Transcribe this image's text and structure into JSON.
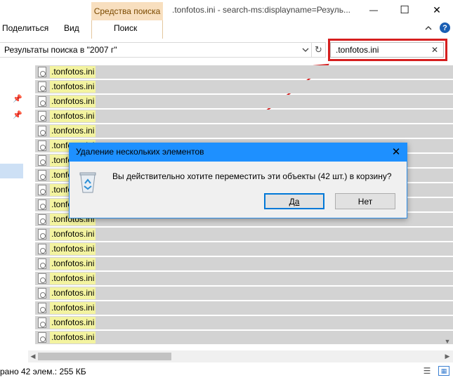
{
  "window": {
    "title": ".tonfotos.ini - search-ms:displayname=Резуль...",
    "minimize_symbol": "—",
    "maximize_symbol": "☐",
    "close_symbol": "✕"
  },
  "ribbon": {
    "contextual_header": "Средства поиска",
    "tabs": [
      {
        "label": "Поделиться"
      },
      {
        "label": "Вид"
      },
      {
        "label": "Поиск"
      }
    ],
    "collapse_symbol": "⌄",
    "help_symbol": "?"
  },
  "address_bar": {
    "path": "Результаты поиска в \"2007 г\"",
    "dropdown_symbol": "⌄",
    "refresh_symbol": "↻"
  },
  "search": {
    "value": ".tonfotos.ini",
    "clear_symbol": "✕"
  },
  "nav_pane": {
    "pin_symbol": "📌"
  },
  "file_list": {
    "items": [
      ".tonfotos.ini",
      ".tonfotos.ini",
      ".tonfotos.ini",
      ".tonfotos.ini",
      ".tonfotos.ini",
      ".tonfotos.ini",
      ".tonfotos.ini",
      ".tonfotos.ini",
      ".tonfotos.ini",
      ".tonfotos.ini",
      ".tonfotos.ini",
      ".tonfotos.ini",
      ".tonfotos.ini",
      ".tonfotos.ini",
      ".tonfotos.ini",
      ".tonfotos.ini",
      ".tonfotos.ini",
      ".tonfotos.ini",
      ".tonfotos.ini"
    ]
  },
  "status_bar": {
    "text": "рано 42 элем.: 255 КБ"
  },
  "dialog": {
    "title": "Удаление нескольких элементов",
    "message": "Вы действительно хотите переместить эти объекты (42 шт.) в корзину?",
    "yes_label": "Да",
    "no_label": "Нет",
    "close_symbol": "✕"
  },
  "colors": {
    "highlight_red": "#d61f1f",
    "dialog_titlebar": "#1e90ff",
    "selection_gray": "#d3d3d3",
    "match_highlight": "#f3f3a0",
    "contextual_tab": "#f8dfbf"
  },
  "icons": [
    "file-icon",
    "recycle-bin-icon",
    "pin-icon",
    "refresh-icon",
    "help-icon",
    "close-icon"
  ]
}
